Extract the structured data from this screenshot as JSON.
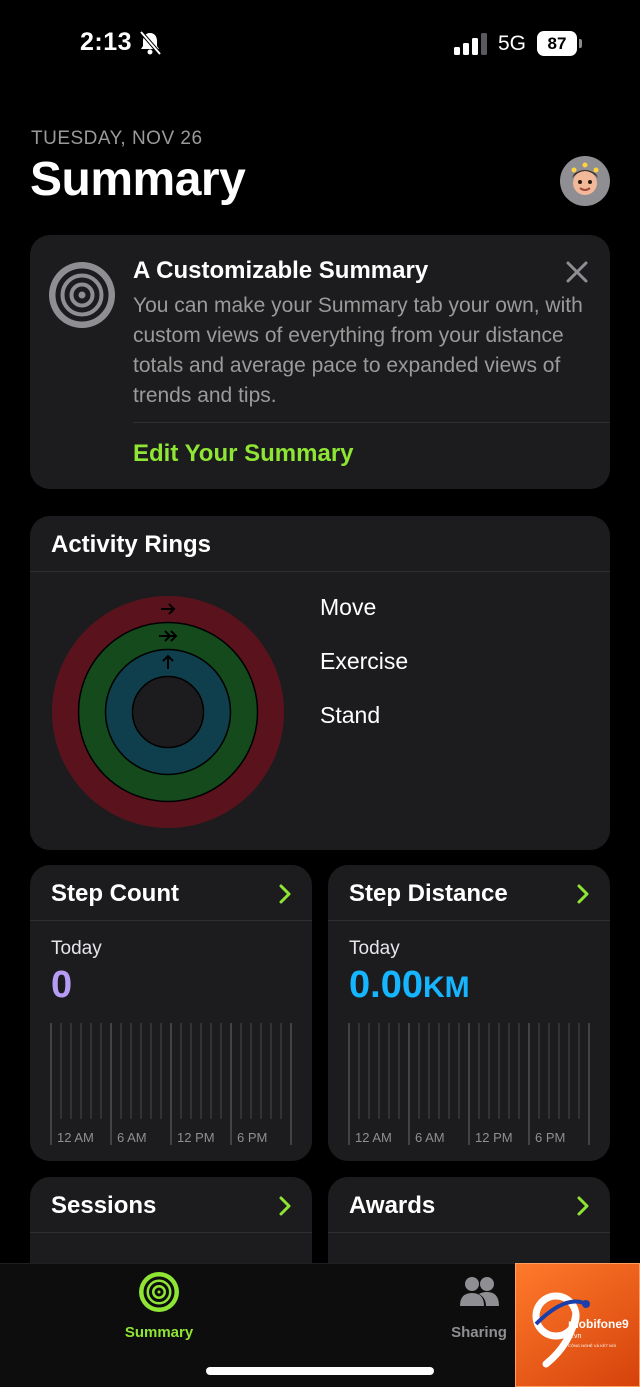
{
  "status_bar": {
    "time": "2:13",
    "network": "5G",
    "battery": "87"
  },
  "header": {
    "date": "TUESDAY, NOV 26",
    "title": "Summary"
  },
  "promo_card": {
    "title": "A Customizable Summary",
    "body": "You can make your Summary tab your own, with custom views of everything from your distance totals and average pace to expanded views of trends and tips.",
    "link": "Edit Your Summary"
  },
  "activity_rings": {
    "title": "Activity Rings",
    "labels": [
      "Move",
      "Exercise",
      "Stand"
    ],
    "progress": {
      "move": 0,
      "exercise": 0,
      "stand": 0
    }
  },
  "step_count": {
    "title": "Step Count",
    "period": "Today",
    "value": "0",
    "time_labels": [
      "12 AM",
      "6 AM",
      "12 PM",
      "6 PM"
    ]
  },
  "step_distance": {
    "title": "Step Distance",
    "period": "Today",
    "value": "0.00",
    "unit": "KM",
    "time_labels": [
      "12 AM",
      "6 AM",
      "12 PM",
      "6 PM"
    ]
  },
  "sessions": {
    "title": "Sessions"
  },
  "awards": {
    "title": "Awards"
  },
  "tab_bar": {
    "items": [
      {
        "label": "Summary"
      },
      {
        "label": "Sharing"
      }
    ]
  },
  "watermark": {
    "brand": "mobifone9",
    "domain": ".vn",
    "tagline": "CÔNG NGHỆ VÀ KẾT NỐI"
  },
  "colors": {
    "accent_green": "#8ee533",
    "step_count_purple": "#b69cf4",
    "distance_blue": "#16b5ff",
    "move_ring": "#5a131c",
    "exercise_ring": "#154a1c",
    "stand_ring": "#0f3f4d"
  }
}
